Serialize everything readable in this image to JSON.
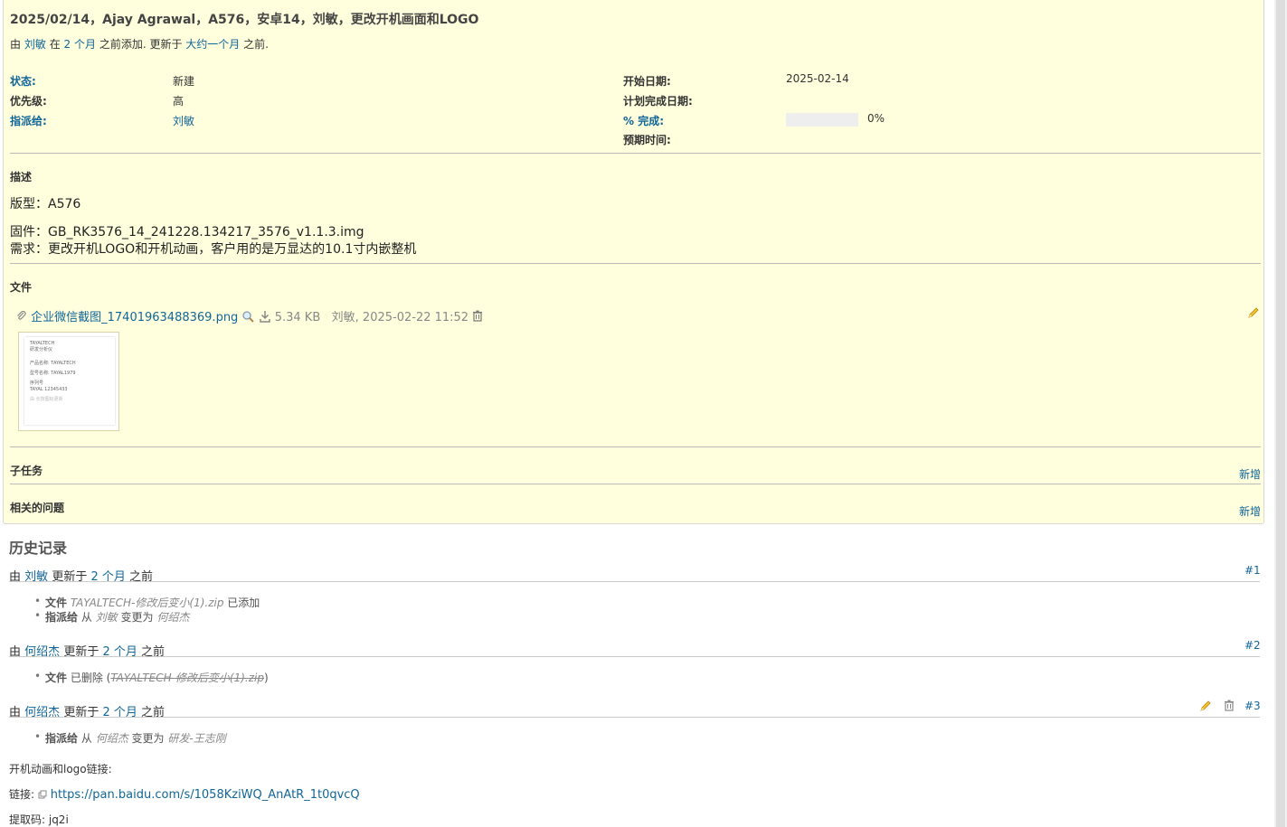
{
  "issue": {
    "title": "2025/02/14，Ajay Agrawal，A576，安卓14，刘敏，更改开机画面和LOGO",
    "author_prefix": "由",
    "author": "刘敏",
    "author_in": "在",
    "added_ago": "2 个月",
    "added_suffix": "之前添加. 更新于",
    "updated_ago": "大约一个月",
    "updated_suffix": "之前.",
    "fields_left": [
      {
        "label": "状态:",
        "value": "新建"
      },
      {
        "label": "优先级:",
        "value": "高"
      },
      {
        "label": "指派给:",
        "value": "刘敏"
      }
    ],
    "fields_right": [
      {
        "label": "开始日期:",
        "value": "2025-02-14"
      },
      {
        "label": "计划完成日期:",
        "value": ""
      },
      {
        "label": "% 完成:",
        "value": "0%"
      },
      {
        "label": "预期时间:",
        "value": ""
      }
    ],
    "progress": 0,
    "description_title": "描述",
    "description": [
      "版型：A576",
      "固件：GB_RK3576_14_241228.134217_3576_v1.1.3.img",
      "需求：更改开机LOGO和开机动画，客户用的是万显达的10.1寸内嵌整机"
    ],
    "files_title": "文件",
    "file": {
      "name": "企业微信截图_17401963488369.png",
      "size": "5.34 KB",
      "meta": "刘敏, 2025-02-22 11:52"
    },
    "thumb_lines": [
      "TAYALTECH",
      "研发分析仪",
      "产品名称: TAYALTECH",
      "型号名称: TAYAL1979",
      "序列号",
      "TAYAL 12345433",
      "由 长按图标更新"
    ],
    "subtasks_title": "子任务",
    "related_title": "相关的问题",
    "new_label": "新增"
  },
  "history": {
    "title": "历史记录",
    "journals": [
      {
        "by": "由",
        "user": "刘敏",
        "upd": "更新于",
        "ago": "2 个月",
        "suffix": "之前",
        "num": "#1",
        "details": [
          {
            "field": "文件",
            "value": "TAYALTECH-修改后变小(1).zip",
            "action": "已添加"
          },
          {
            "field": "指派给",
            "from": "从",
            "old": "刘敏",
            "to": "变更为",
            "new": "何绍杰"
          }
        ]
      },
      {
        "by": "由",
        "user": "何绍杰",
        "upd": "更新于",
        "ago": "2 个月",
        "suffix": "之前",
        "num": "#2",
        "details": [
          {
            "field": "文件",
            "action": "已删除",
            "value": "TAYALTECH-修改后变小(1).zip"
          }
        ]
      },
      {
        "by": "由",
        "user": "何绍杰",
        "upd": "更新于",
        "ago": "2 个月",
        "suffix": "之前",
        "num": "#3",
        "details": [
          {
            "field": "指派给",
            "from": "从",
            "old": "何绍杰",
            "to": "变更为",
            "new": "研发-王志刚"
          }
        ]
      }
    ],
    "notes": {
      "line1": "开机动画和logo链接:",
      "link_label": "链接:",
      "link": "https://pan.baidu.com/s/1058KziWQ_AnAtR_1t0qvcQ",
      "code": "提取码: jq2i"
    }
  }
}
